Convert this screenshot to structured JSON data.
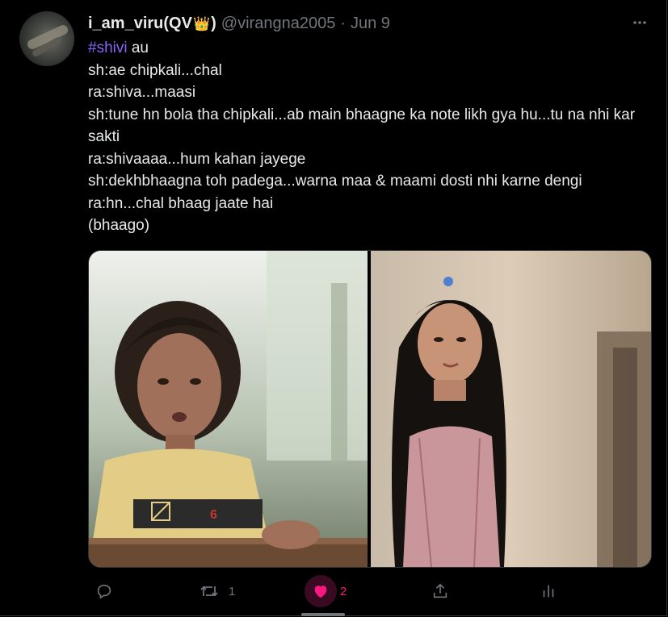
{
  "tweet": {
    "display_name": "i_am_viru(QV",
    "display_name_suffix": ")",
    "crown_emoji": "👑",
    "handle": "@virangna2005",
    "separator": "·",
    "date": "Jun 9",
    "hashtag": "#shivi",
    "first_line_rest": " au",
    "lines": [
      "sh:ae chipkali...chal",
      "ra:shiva...maasi",
      "sh:tune hn bola tha chipkali...ab main bhaagne ka note likh gya hu...tu na nhi kar sakti",
      "ra:shivaaaa...hum kahan jayege",
      "sh:dekhbhaagna toh padega...warna maa & maami dosti nhi karne dengi",
      "ra:hn...chal bhaag jaate hai",
      "(bhaago)"
    ]
  },
  "actions": {
    "reply_count": "",
    "retweet_count": "1",
    "like_count": "2",
    "liked": true
  },
  "icons": {
    "more": "more-dots-icon",
    "reply": "reply-icon",
    "retweet": "retweet-icon",
    "like": "heart-icon",
    "share": "share-icon",
    "analytics": "analytics-icon"
  },
  "colors": {
    "background": "#000000",
    "text": "#e7e9ea",
    "muted": "#71767b",
    "hashtag": "#8a66f6",
    "like": "#f91880"
  }
}
